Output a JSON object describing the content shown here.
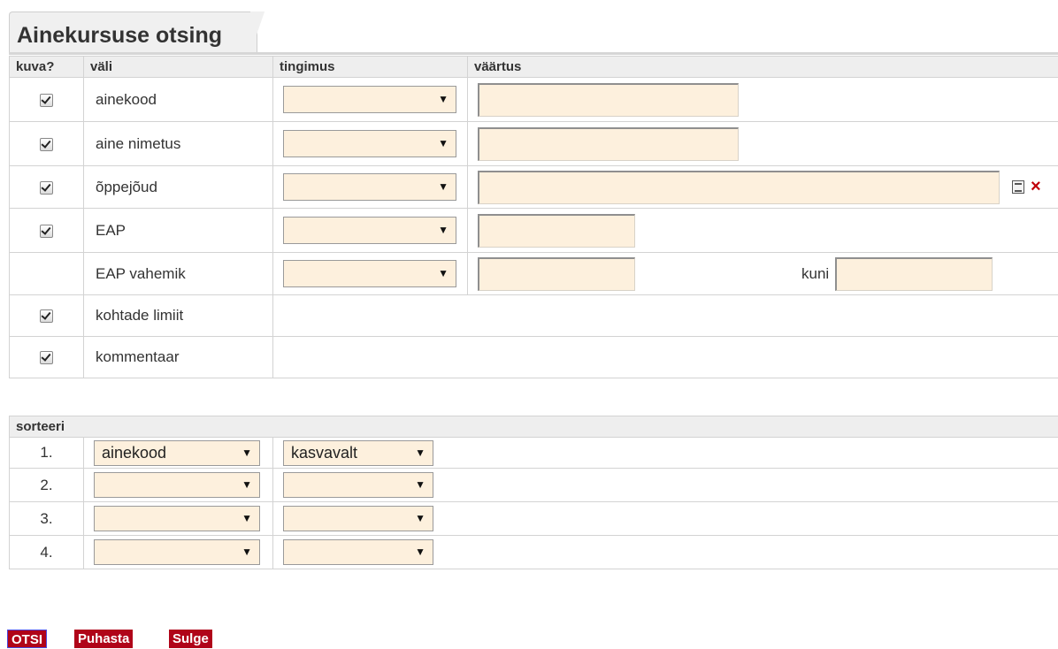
{
  "title": "Ainekursuse otsing",
  "columns": {
    "show": "kuva?",
    "field": "väli",
    "condition": "tingimus",
    "value": "väärtus"
  },
  "fields": [
    {
      "label": "ainekood",
      "checked": true
    },
    {
      "label": "aine nimetus",
      "checked": true
    },
    {
      "label": "õppejõud",
      "checked": true
    },
    {
      "label": "EAP",
      "checked": true
    },
    {
      "label": "EAP vahemik",
      "checked": false,
      "range_label": "kuni"
    },
    {
      "label": "kohtade limiit",
      "checked": true
    },
    {
      "label": "kommentaar",
      "checked": true
    }
  ],
  "sort": {
    "header": "sorteeri",
    "rows": [
      {
        "num": "1.",
        "field": "ainekood",
        "order": "kasvavalt"
      },
      {
        "num": "2.",
        "field": "",
        "order": ""
      },
      {
        "num": "3.",
        "field": "",
        "order": ""
      },
      {
        "num": "4.",
        "field": "",
        "order": ""
      }
    ]
  },
  "buttons": {
    "search": "OTSI",
    "clear": "Puhasta",
    "close": "Sulge"
  },
  "icons": {
    "list": "list-icon",
    "remove": "close-icon"
  },
  "colors": {
    "input_bg": "#fdf0dd",
    "button_bg": "#b00419",
    "header_bg": "#eeeeee"
  }
}
